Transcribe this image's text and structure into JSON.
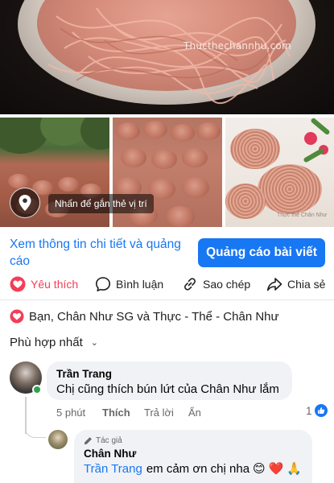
{
  "hero": {
    "watermark": "Thucthechannhu.com"
  },
  "photos": {
    "location_tip": "Nhấn để gắn thẻ vị trí",
    "photo_watermark": "Thực thể Chân Như"
  },
  "ad": {
    "details_link": "Xem thông tin chi tiết và quảng cáo",
    "boost_button": "Quảng cáo bài viết"
  },
  "actions": {
    "like": "Yêu thích",
    "comment": "Bình luận",
    "copy": "Sao chép",
    "share": "Chia sẻ"
  },
  "reactions": {
    "summary": "Bạn, Chân Như SG và Thực - Thể - Chân Như"
  },
  "sort": {
    "label": "Phù hợp nhất"
  },
  "comments": [
    {
      "author": "Trần Trang",
      "text": "Chị cũng thích bún lứt của Chân Như lắm",
      "time": "5 phút",
      "like": "Thích",
      "reply": "Trả lời",
      "hide": "Ẩn",
      "like_count": "1"
    }
  ],
  "reply": {
    "badge": "Tác giả",
    "author": "Chân Như",
    "mention": "Trần Trang",
    "text": "em cảm ơn chị nha",
    "emojis": [
      "😊",
      "❤️",
      "🙏"
    ]
  },
  "colors": {
    "accent": "#1877f2",
    "love": "#f33e58",
    "online": "#31a24c",
    "bubble": "#f0f2f5"
  }
}
